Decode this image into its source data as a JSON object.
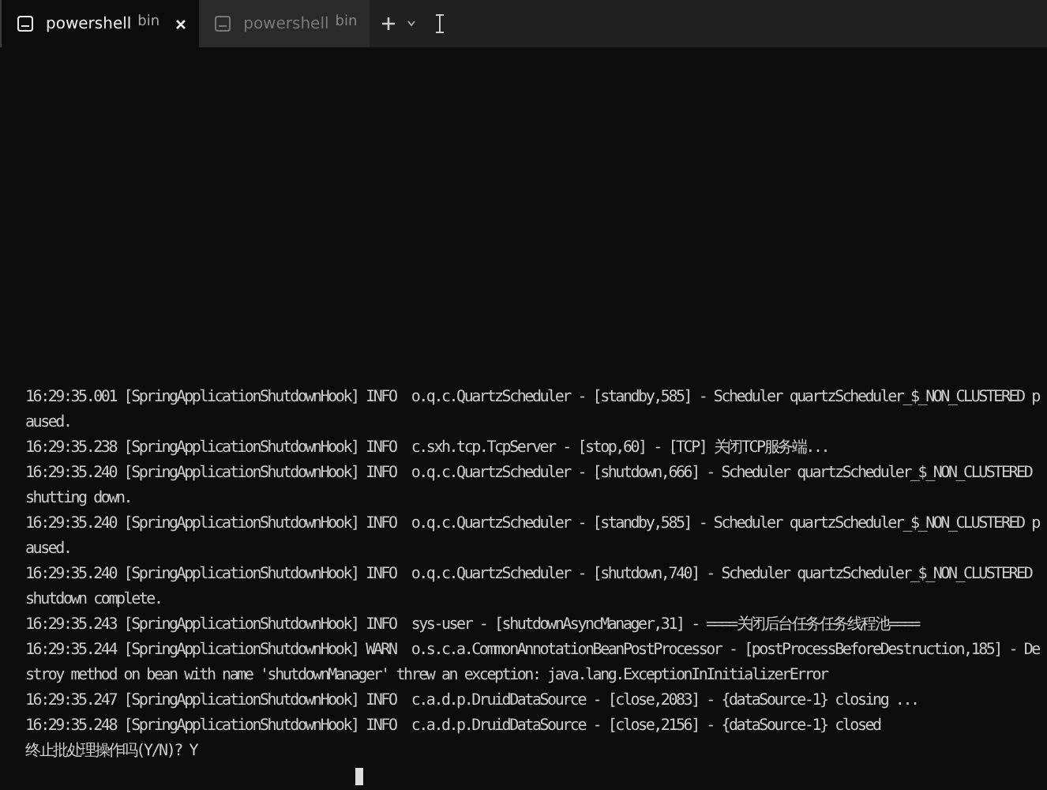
{
  "tabs": [
    {
      "title": "powershell",
      "subtitle": "bin",
      "selected": true
    },
    {
      "title": "powershell",
      "subtitle": "bin",
      "selected": false
    }
  ],
  "terminal": {
    "lines": [
      "16:29:35.001 [SpringApplicationShutdownHook] INFO  o.q.c.QuartzScheduler - [standby,585] - Scheduler quartzScheduler_$_NON_CLUSTERED p",
      "aused.",
      "16:29:35.238 [SpringApplicationShutdownHook] INFO  c.sxh.tcp.TcpServer - [stop,60] - [TCP] 关闭TCP服务端...",
      "16:29:35.240 [SpringApplicationShutdownHook] INFO  o.q.c.QuartzScheduler - [shutdown,666] - Scheduler quartzScheduler_$_NON_CLUSTERED",
      "shutting down.",
      "16:29:35.240 [SpringApplicationShutdownHook] INFO  o.q.c.QuartzScheduler - [standby,585] - Scheduler quartzScheduler_$_NON_CLUSTERED p",
      "aused.",
      "16:29:35.240 [SpringApplicationShutdownHook] INFO  o.q.c.QuartzScheduler - [shutdown,740] - Scheduler quartzScheduler_$_NON_CLUSTERED",
      "shutdown complete.",
      "16:29:35.243 [SpringApplicationShutdownHook] INFO  sys-user - [shutdownAsyncManager,31] - ====关闭后台任务任务线程池====",
      "16:29:35.244 [SpringApplicationShutdownHook] WARN  o.s.c.a.CommonAnnotationBeanPostProcessor - [postProcessBeforeDestruction,185] - De",
      "stroy method on bean with name 'shutdownManager' threw an exception: java.lang.ExceptionInInitializerError",
      "16:29:35.247 [SpringApplicationShutdownHook] INFO  c.a.d.p.DruidDataSource - [close,2083] - {dataSource-1} closing ...",
      "16:29:35.248 [SpringApplicationShutdownHook] INFO  c.a.d.p.DruidDataSource - [close,2156] - {dataSource-1} closed",
      "终止批处理操作吗(Y/N)? Y"
    ]
  }
}
